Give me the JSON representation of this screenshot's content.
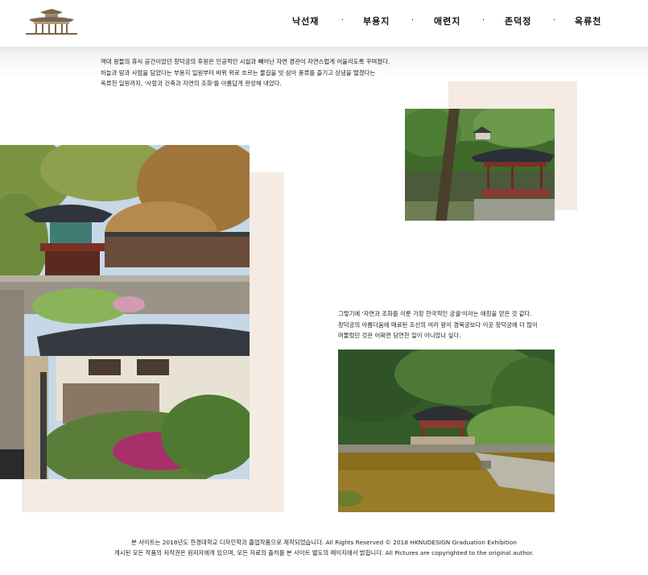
{
  "nav": {
    "items": [
      "낙선재",
      "부용지",
      "애련지",
      "존덕정",
      "옥류천"
    ],
    "separator": "·"
  },
  "intro": {
    "text": "역대 왕들의 휴식 공간이었던 창덕궁의 후원은 인공적인 시설과 빼어난 자연 경관이 자연스럽게 어울리도록 꾸며졌다.\n하늘과 땅과 사람을 담았다는 부용지 일원부터 바위 위로 흐르는 물길을 빗 삼아 풍류를 즐기고 상념을 떨쳤다는\n옥류천 일원까지, '사람과 건축과 자연의  조화'를 아름답게 완성해 내었다."
  },
  "quote": {
    "text": "그렇기에 '자연과 조화를 이룬 가장 한국적인 궁궐'이라는 애칭을 얻은 것 같다.\n창덕궁의 아름다움에 매료된 조선의 여러 왕이 경복궁보다 이곳 창덕궁에 더 많이\n머물렀던 것은 어쩌면 당연한 일이 아니었나 싶다."
  },
  "photos": {
    "palace_icon": "palace-logo-icon",
    "large": "palace-garden-photo",
    "pavilion": "pond-pavilion-photo",
    "pond": "pond-garden-photo"
  },
  "colors": {
    "accent_beige": "#f5ebe2",
    "nav_text": "#111111"
  },
  "footer": {
    "line1": "본 사이트는 2018년도 한경대학교 디자인학과 졸업작품으로 제작되었습니다.  All Rights Reserved © 2018 HKNUDESIGN Graduation Exhibition",
    "line2": "게시된 모든 작품의 저작권은 원저자에게 있으며, 모든 자료의 출처를 본 사이트 별도의 페이지에서 밝힙니다.  All Pictures are copyrighted to the original author."
  }
}
